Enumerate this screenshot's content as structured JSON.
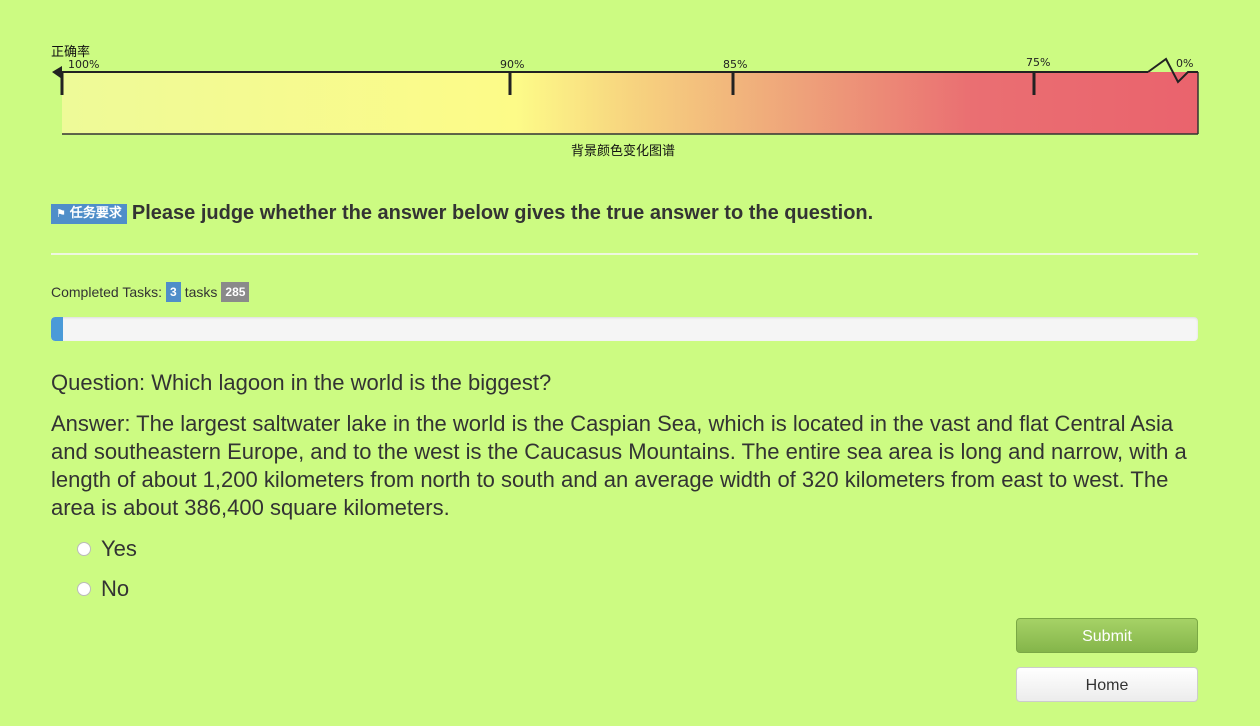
{
  "scale": {
    "title": "正确率",
    "caption": "背景颜色变化图谱",
    "labels": [
      "100%",
      "90%",
      "85%",
      "75%",
      "0%"
    ],
    "colors": {
      "start": "#f0fa94",
      "mid": "#fffa88",
      "end": "#ea636d"
    }
  },
  "task": {
    "badge_icon": "megaphone-icon",
    "badge_label": "任务要求",
    "instruction": "Please judge whether the answer below gives the true answer to the question."
  },
  "progress": {
    "completed_label": "Completed Tasks:",
    "completed": "3",
    "tasks_label": "tasks",
    "total": "285",
    "fraction": 0.0105
  },
  "question": "Question: Which lagoon in the world is the biggest?",
  "answer": "Answer: The largest saltwater lake in the world is the Caspian Sea, which is located in the vast and flat Central Asia and southeastern Europe, and to the west is the Caucasus Mountains. The entire sea area is long and narrow, with a length of about 1,200 kilometers from north to south and an average width of 320 kilometers from east to west. The area is about 386,400 square kilometers.",
  "options": [
    {
      "label": "Yes",
      "selected": false
    },
    {
      "label": "No",
      "selected": false
    }
  ],
  "buttons": {
    "submit": "Submit",
    "home": "Home"
  }
}
